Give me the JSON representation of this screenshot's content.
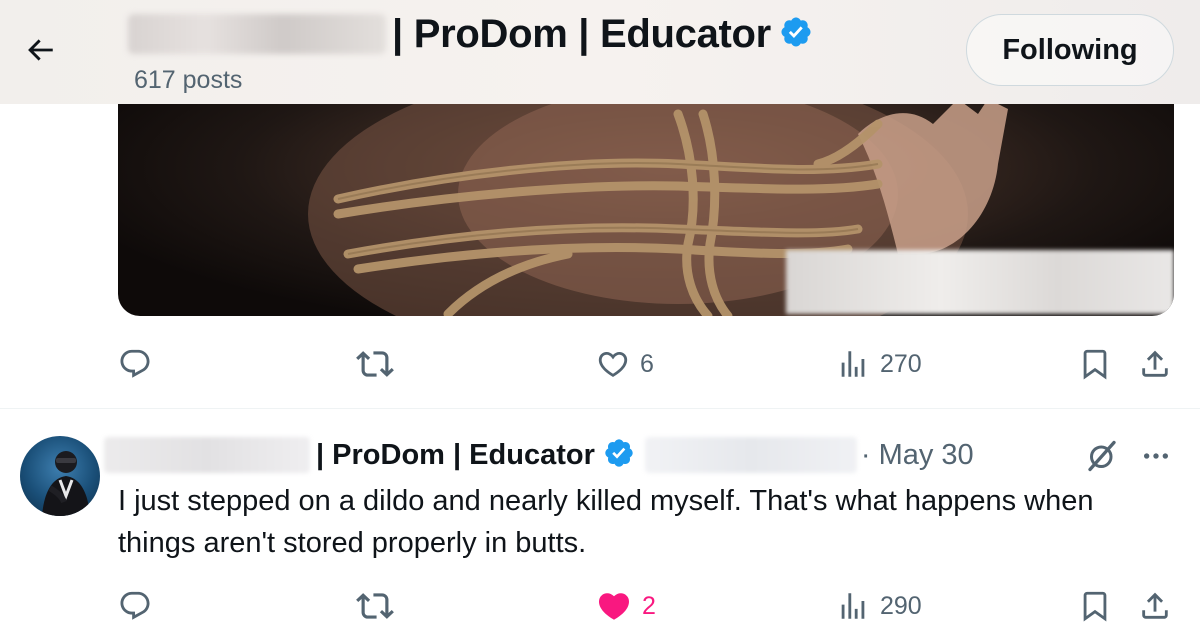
{
  "header": {
    "title": "| ProDom | Educator",
    "posts_count": "617 posts",
    "following_label": "Following"
  },
  "post1": {
    "likes": "6",
    "views": "270"
  },
  "post2": {
    "author_display": "| ProDom | Educator",
    "date": "· May 30",
    "text": "I just stepped on a dildo and nearly killed myself. That's what happens when things aren't stored properly in butts.",
    "likes": "2",
    "views": "290",
    "liked": true
  },
  "colors": {
    "verified_blue": "#1d9bf0",
    "like_pink": "#f91880",
    "secondary_text": "#536471"
  },
  "icons": [
    "back-arrow-icon",
    "verified-badge-icon",
    "reply-icon",
    "retweet-icon",
    "heart-icon",
    "views-icon",
    "bookmark-icon",
    "share-icon",
    "grok-icon",
    "more-icon"
  ]
}
